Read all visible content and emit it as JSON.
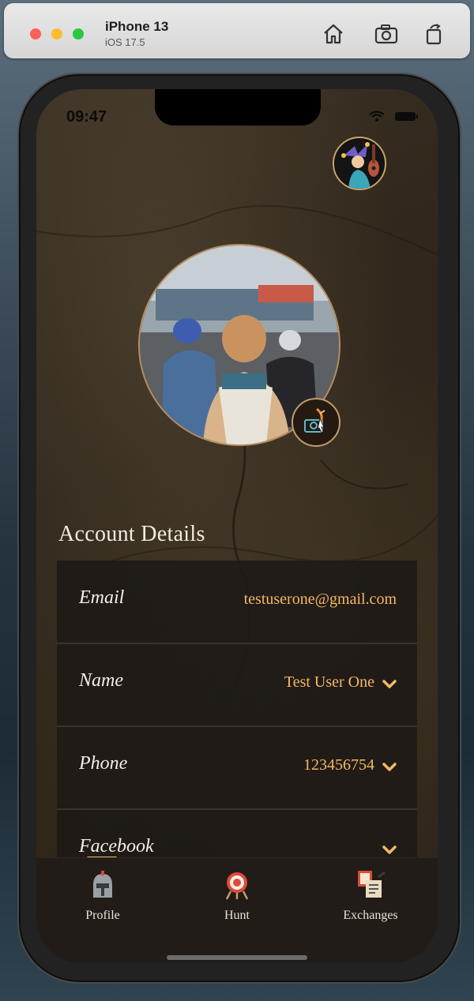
{
  "simulator": {
    "device_name": "iPhone 13",
    "os_version": "iOS 17.5"
  },
  "status_bar": {
    "time": "09:47"
  },
  "account": {
    "section_title": "Account Details",
    "rows": [
      {
        "label": "Email",
        "value": "testuserone@gmail.com",
        "has_chevron": false
      },
      {
        "label": "Name",
        "value": "Test User One",
        "has_chevron": true
      },
      {
        "label": "Phone",
        "value": "123456754",
        "has_chevron": true
      },
      {
        "label": "Facebook",
        "value": "",
        "has_chevron": true
      }
    ]
  },
  "tabbar": {
    "tabs": [
      {
        "label": "Profile",
        "icon": "helmet-icon"
      },
      {
        "label": "Hunt",
        "icon": "target-icon"
      },
      {
        "label": "Exchanges",
        "icon": "documents-icon"
      }
    ]
  },
  "colors": {
    "accent": "#f5b865",
    "background": "#2c241a",
    "text": "#f3efe6"
  }
}
